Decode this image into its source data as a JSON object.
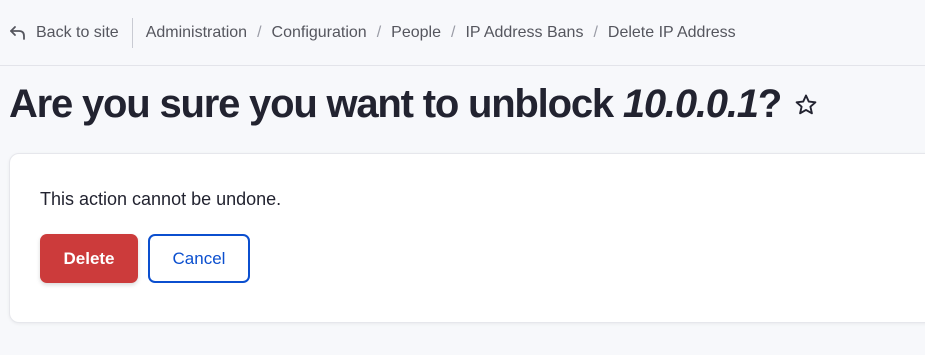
{
  "topbar": {
    "back_label": "Back to site",
    "breadcrumbs": [
      "Administration",
      "Configuration",
      "People",
      "IP Address Bans",
      "Delete IP Address"
    ],
    "separator": "/"
  },
  "page": {
    "title_prefix": "Are you sure you want to unblock ",
    "title_ip": "10.0.0.1",
    "title_suffix": "?"
  },
  "form": {
    "warning": "This action cannot be undone.",
    "delete_label": "Delete",
    "cancel_label": "Cancel"
  },
  "colors": {
    "danger": "#cc3b3b",
    "primary": "#0b4fcf"
  }
}
